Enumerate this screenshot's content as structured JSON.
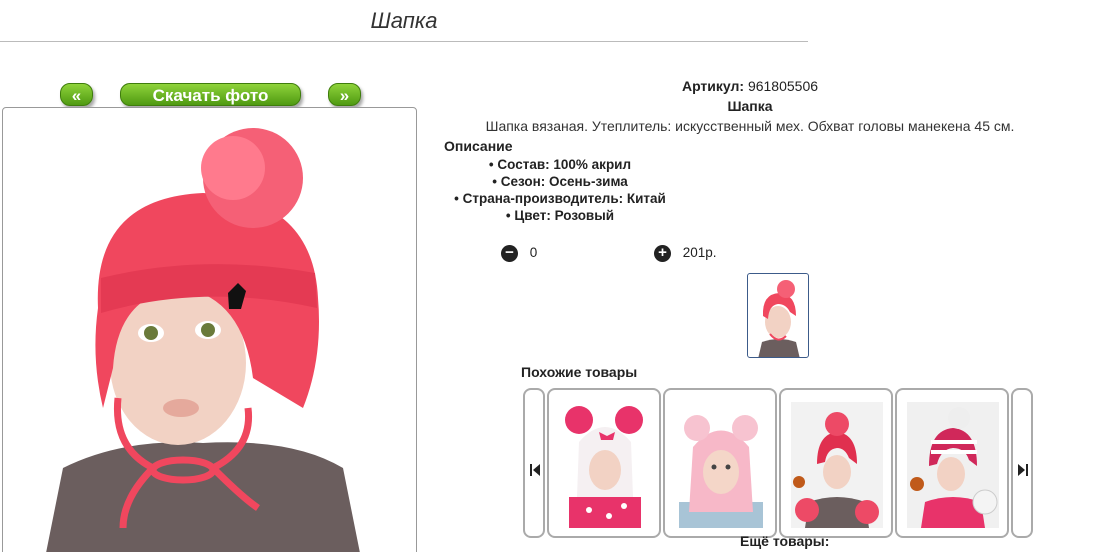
{
  "page": {
    "title": "Шапка"
  },
  "gallery": {
    "prev_label": "«",
    "download_label": "Скачать фото",
    "next_label": "»"
  },
  "product": {
    "article_label": "Артикул:",
    "article_value": "961805506",
    "name": "Шапка",
    "short_desc": "Шапка вязаная. Утеплитель: искусственный мех. Обхват головы манекена 45 см.",
    "desc_heading": "Описание",
    "properties": [
      "Состав: 100% акрил",
      "Сезон: Осень-зима",
      "Страна-производитель: Китай",
      "Цвет: Розовый"
    ],
    "quantity": "0",
    "price": "201р.",
    "colors": {
      "hat": "#f0475e",
      "sweater": "#6b5e5e",
      "accent": "#58a81a"
    }
  },
  "similar": {
    "title": "Похожие товары",
    "items": [
      {
        "icon": "pink-white-pompom-hat"
      },
      {
        "icon": "light-pink-balaclava"
      },
      {
        "icon": "pink-knit-hat-scarf"
      },
      {
        "icon": "striped-pink-hat"
      }
    ]
  },
  "more": {
    "title": "Ещё товары:"
  }
}
